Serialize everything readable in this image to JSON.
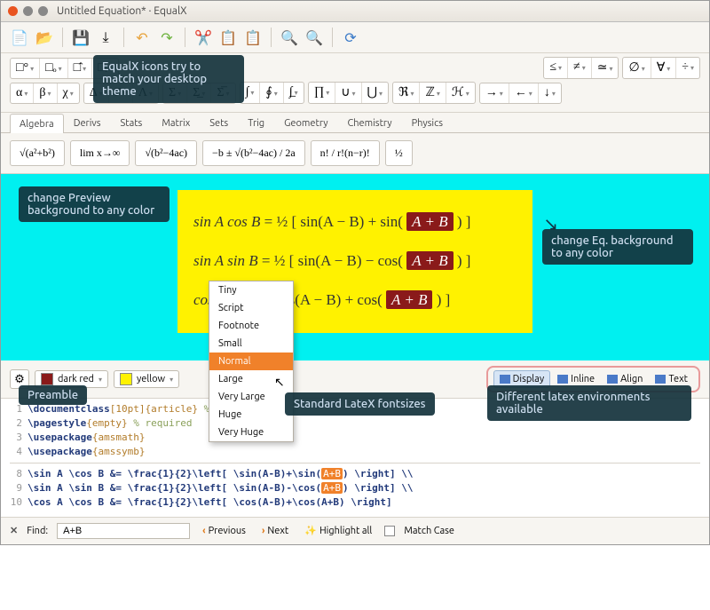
{
  "window": {
    "title": "Untitled Equation* · EqualX"
  },
  "annotations": {
    "icons_match_theme": "EqualX icons try to match your desktop theme",
    "preview_bg": "change Preview background to any color",
    "eq_bg": "change Eq. background to any color",
    "fontsizes": "Standard LateX fontsizes",
    "preamble": "Preamble",
    "environments": "Different latex environments available"
  },
  "tabs": {
    "items": [
      "Algebra",
      "Derivs",
      "Stats",
      "Matrix",
      "Sets",
      "Trig",
      "Geometry",
      "Chemistry",
      "Physics"
    ],
    "active": 0
  },
  "templates": [
    "√(a²+b²)",
    "lim x→∞",
    "√(b²−4ac)",
    "−b ± √(b²−4ac) / 2a",
    "n! / r!(n−r)!",
    "½"
  ],
  "colors": {
    "fg_name": "dark red",
    "fg_hex": "#8a1a1a",
    "bg_name": "yellow",
    "bg_hex": "#fff200"
  },
  "font_sizes": [
    "Tiny",
    "Script",
    "Footnote",
    "Small",
    "Normal",
    "Large",
    "Very Large",
    "Huge",
    "Very Huge"
  ],
  "font_size_selected": "Normal",
  "environments": {
    "items": [
      "Display",
      "Inline",
      "Align",
      "Text"
    ],
    "active": "Display"
  },
  "preview": {
    "lines": [
      {
        "lhs": "sin A cos B",
        "frac": "½",
        "t1": "sin(A − B)",
        "op": "+",
        "t2fn": "sin(",
        "hl": "A + B"
      },
      {
        "lhs": "sin A sin B",
        "frac": "½",
        "t1": "sin(A − B)",
        "op": "−",
        "t2fn": "cos(",
        "hl": "A + B"
      },
      {
        "lhs": "cos A cos",
        "frac": "",
        "t1": "cos(A − B)",
        "op": "+",
        "t2fn": "cos(",
        "hl": "A + B"
      }
    ]
  },
  "editor": {
    "preamble": [
      {
        "n": 1,
        "a": "\\documentclass",
        "b": "[10pt]{article}",
        "c": " % required"
      },
      {
        "n": 2,
        "a": "\\pagestyle",
        "b": "{empty}",
        "c": " % required"
      },
      {
        "n": 3,
        "a": "\\usepackage",
        "b": "{amsmath}",
        "c": ""
      },
      {
        "n": 4,
        "a": "\\usepackage",
        "b": "{amssymb}",
        "c": ""
      }
    ],
    "body": [
      {
        "n": 8,
        "txt": "\\sin A \\cos B &= \\frac{1}{2}\\left[ \\sin(A-B)+\\sin(",
        "hl": "A+B",
        "tail": ") \\right] \\\\"
      },
      {
        "n": 9,
        "txt": "\\sin A \\sin B &= \\frac{1}{2}\\left[ \\sin(A-B)-\\cos(",
        "hl": "A+B",
        "tail": ") \\right] \\\\"
      },
      {
        "n": 10,
        "txt": "\\cos A \\cos B &= \\frac{1}{2}\\left[ \\cos(A-B)+\\cos(A+B) \\right]",
        "hl": "",
        "tail": ""
      }
    ]
  },
  "find": {
    "label": "Find:",
    "value": "A+B",
    "prev": "Previous",
    "next": "Next",
    "highlight": "Highlight all",
    "matchcase": "Match Case"
  }
}
